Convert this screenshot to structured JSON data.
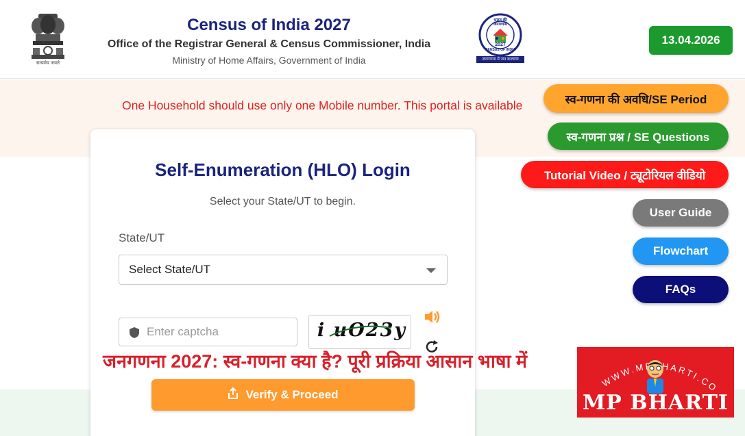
{
  "header": {
    "title": "Census of India 2027",
    "subtitle": "Office of the Registrar General & Census Commissioner, India",
    "ministry": "Ministry of Home Affairs, Government of India",
    "emblem_motto": "सत्यमेव जयते",
    "census_logo_text": "भारत की जनगणना",
    "census_logo_year": "2027",
    "census_logo_bottom": "CENSUS OF INDIA",
    "census_logo_tagline": "जनगणना में जन कल्याण",
    "date": "13.04.2026"
  },
  "notice": "One Household should use only one Mobile number. This portal is available",
  "login": {
    "title": "Self-Enumeration (HLO) Login",
    "subtitle": "Select your State/UT to begin.",
    "state_label": "State/UT",
    "state_selected": "Select State/UT",
    "captcha_placeholder": "Enter captcha",
    "captcha_text": "i uO23y",
    "verify_label": "Verify & Proceed"
  },
  "side_buttons": {
    "se_period": "स्व-गणना की अवधि/SE Period",
    "se_questions": "स्व-गणना प्रश्न / SE Questions",
    "tutorial": "Tutorial Video / ट्यूटोरियल वीडियो",
    "user_guide": "User Guide",
    "flowchart": "Flowchart",
    "faqs": "FAQs"
  },
  "overlay_caption": "जनगणना 2027: स्व-गणना क्या है? पूरी प्रक्रिया आसान भाषा में",
  "watermark": {
    "url": "WWW.MPBHARTI.COM",
    "brand": "MP BHARTI"
  },
  "colors": {
    "navy": "#1a237e",
    "green": "#1b9a2e",
    "orange": "#ff9a2e",
    "red": "#ff1a1a",
    "notice_red": "#e02020"
  }
}
